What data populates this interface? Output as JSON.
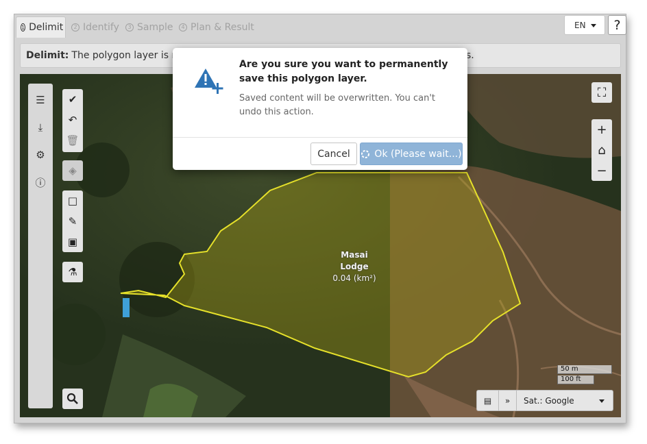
{
  "tabs": [
    {
      "num": "1",
      "label": "Delimit",
      "active": true
    },
    {
      "num": "2",
      "label": "Identify",
      "active": false
    },
    {
      "num": "3",
      "label": "Sample",
      "active": false
    },
    {
      "num": "4",
      "label": "Plan & Result",
      "active": false
    }
  ],
  "language": "EN",
  "help_label": "?",
  "infobar": {
    "strong": "Delimit:",
    "text_left": "The polygon layer is modi",
    "text_right": "s."
  },
  "polygon": {
    "name": "Masai Lodge",
    "area": "0.04 (km²)"
  },
  "scale": {
    "metric": "50 m",
    "imperial": "100 ft"
  },
  "basemap": {
    "selected": "Sat.: Google",
    "expand_label": "»"
  },
  "modal": {
    "title": "Are you sure you want to permanently save this polygon layer.",
    "message": "Saved content will be overwritten. You can't undo this action.",
    "cancel_label": "Cancel",
    "ok_label": "Ok (Please wait...)"
  },
  "colors": {
    "accent": "#8fb4d8",
    "polygon_stroke": "#e6e12a",
    "icon_blue": "#2f74b5"
  }
}
